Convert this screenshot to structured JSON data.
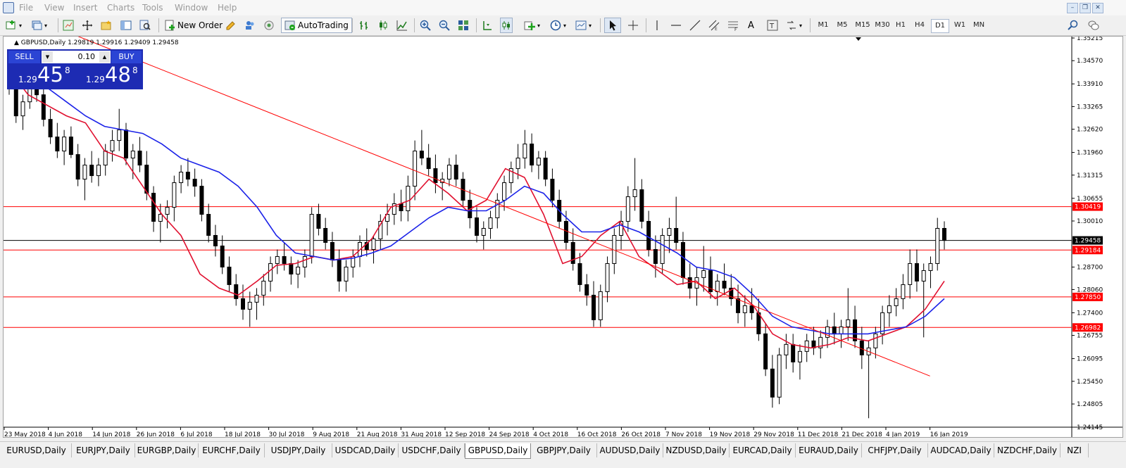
{
  "menu": [
    "File",
    "View",
    "Insert",
    "Charts",
    "Tools",
    "Window",
    "Help"
  ],
  "toolbar": {
    "new_order": "New Order",
    "autotrading": "AutoTrading"
  },
  "timeframes": [
    "M1",
    "M5",
    "M15",
    "M30",
    "H1",
    "H4",
    "D1",
    "W1",
    "MN"
  ],
  "active_timeframe": "D1",
  "symbol_line": "GBPUSD,Daily  1.29819 1.29916 1.29409 1.29458",
  "trade_panel": {
    "sell": "SELL",
    "buy": "BUY",
    "lot": "0.10",
    "sell_small": "1.29",
    "sell_big": "45",
    "sell_sup": "8",
    "buy_small": "1.29",
    "buy_big": "48",
    "buy_sup": "8"
  },
  "chart_data": {
    "type": "candlestick",
    "symbol": "GBPUSD",
    "period": "Daily",
    "price_axis": [
      "1.35215",
      "1.34570",
      "1.33910",
      "1.33265",
      "1.32620",
      "1.31960",
      "1.31315",
      "1.30655",
      "1.30010",
      "1.29458",
      "1.28700",
      "1.28060",
      "1.27400",
      "1.26755",
      "1.26095",
      "1.25450",
      "1.24805",
      "1.24145"
    ],
    "date_axis": [
      "23 May 2018",
      "4 Jun 2018",
      "14 Jun 2018",
      "26 Jun 2018",
      "6 Jul 2018",
      "18 Jul 2018",
      "30 Jul 2018",
      "9 Aug 2018",
      "21 Aug 2018",
      "31 Aug 2018",
      "12 Sep 2018",
      "24 Sep 2018",
      "4 Oct 2018",
      "16 Oct 2018",
      "26 Oct 2018",
      "7 Nov 2018",
      "19 Nov 2018",
      "29 Nov 2018",
      "11 Dec 2018",
      "21 Dec 2018",
      "4 Jan 2019",
      "16 Jan 2019"
    ],
    "ylim": [
      1.24145,
      1.35215
    ],
    "current_price": "1.29458",
    "hlines": [
      {
        "label": "1.30419",
        "price": 1.30419
      },
      {
        "label": "1.29184",
        "price": 1.29184
      },
      {
        "label": "1.27850",
        "price": 1.2785
      },
      {
        "label": "1.26982",
        "price": 1.26982
      }
    ],
    "trendline": {
      "from": [
        "2018-06-04",
        1.356
      ],
      "to": [
        "2019-01-30",
        1.256
      ]
    },
    "series": [
      {
        "name": "MA fast",
        "color": "#e0102f",
        "values": [
          1.343,
          1.336,
          1.333,
          1.33,
          1.328,
          1.32,
          1.318,
          1.31,
          1.302,
          1.296,
          1.285,
          1.281,
          1.279,
          1.283,
          1.2875,
          1.288,
          1.29,
          1.289,
          1.29,
          1.295,
          1.304,
          1.306,
          1.312,
          1.308,
          1.303,
          1.306,
          1.315,
          1.3125,
          1.302,
          1.288,
          1.29,
          1.296,
          1.3,
          1.29,
          1.286,
          1.282,
          1.283,
          1.278,
          1.281,
          1.276,
          1.268,
          1.265,
          1.264,
          1.265,
          1.267,
          1.266,
          1.268,
          1.27,
          1.275,
          1.283
        ]
      },
      {
        "name": "MA slow",
        "color": "#1b22e8",
        "values": [
          1.348,
          1.343,
          1.338,
          1.334,
          1.33,
          1.327,
          1.326,
          1.325,
          1.322,
          1.318,
          1.316,
          1.314,
          1.31,
          1.304,
          1.296,
          1.291,
          1.29,
          1.289,
          1.2895,
          1.291,
          1.293,
          1.297,
          1.301,
          1.304,
          1.303,
          1.303,
          1.306,
          1.31,
          1.308,
          1.302,
          1.297,
          1.297,
          1.299,
          1.297,
          1.294,
          1.291,
          1.287,
          1.286,
          1.284,
          1.279,
          1.273,
          1.27,
          1.269,
          1.268,
          1.268,
          1.268,
          1.269,
          1.27,
          1.273,
          1.278
        ]
      }
    ],
    "candles": [
      [
        1.342,
        1.346,
        1.336,
        1.338
      ],
      [
        1.338,
        1.34,
        1.328,
        1.33
      ],
      [
        1.33,
        1.336,
        1.326,
        1.334
      ],
      [
        1.334,
        1.34,
        1.332,
        1.338
      ],
      [
        1.338,
        1.343,
        1.334,
        1.336
      ],
      [
        1.336,
        1.338,
        1.327,
        1.329
      ],
      [
        1.329,
        1.332,
        1.322,
        1.324
      ],
      [
        1.324,
        1.328,
        1.318,
        1.32
      ],
      [
        1.32,
        1.326,
        1.316,
        1.324
      ],
      [
        1.324,
        1.327,
        1.318,
        1.319
      ],
      [
        1.319,
        1.322,
        1.31,
        1.312
      ],
      [
        1.312,
        1.318,
        1.306,
        1.316
      ],
      [
        1.316,
        1.32,
        1.311,
        1.313
      ],
      [
        1.313,
        1.318,
        1.31,
        1.316
      ],
      [
        1.316,
        1.322,
        1.313,
        1.32
      ],
      [
        1.32,
        1.326,
        1.317,
        1.323
      ],
      [
        1.323,
        1.332,
        1.32,
        1.326
      ],
      [
        1.326,
        1.328,
        1.316,
        1.318
      ],
      [
        1.318,
        1.322,
        1.312,
        1.32
      ],
      [
        1.32,
        1.324,
        1.314,
        1.316
      ],
      [
        1.316,
        1.32,
        1.306,
        1.308
      ],
      [
        1.308,
        1.31,
        1.297,
        1.3
      ],
      [
        1.3,
        1.305,
        1.294,
        1.302
      ],
      [
        1.302,
        1.306,
        1.298,
        1.304
      ],
      [
        1.304,
        1.313,
        1.3,
        1.311
      ],
      [
        1.311,
        1.316,
        1.308,
        1.314
      ],
      [
        1.314,
        1.318,
        1.31,
        1.312
      ],
      [
        1.312,
        1.315,
        1.307,
        1.31
      ],
      [
        1.31,
        1.312,
        1.3,
        1.302
      ],
      [
        1.302,
        1.305,
        1.294,
        1.296
      ],
      [
        1.296,
        1.299,
        1.29,
        1.293
      ],
      [
        1.293,
        1.296,
        1.285,
        1.287
      ],
      [
        1.287,
        1.29,
        1.28,
        1.282
      ],
      [
        1.282,
        1.285,
        1.276,
        1.278
      ],
      [
        1.278,
        1.282,
        1.272,
        1.275
      ],
      [
        1.275,
        1.28,
        1.27,
        1.277
      ],
      [
        1.277,
        1.281,
        1.272,
        1.279
      ],
      [
        1.279,
        1.285,
        1.276,
        1.283
      ],
      [
        1.283,
        1.29,
        1.28,
        1.288
      ],
      [
        1.288,
        1.292,
        1.285,
        1.29
      ],
      [
        1.29,
        1.294,
        1.286,
        1.288
      ],
      [
        1.288,
        1.29,
        1.282,
        1.285
      ],
      [
        1.285,
        1.289,
        1.281,
        1.287
      ],
      [
        1.287,
        1.292,
        1.284,
        1.29
      ],
      [
        1.29,
        1.304,
        1.288,
        1.302
      ],
      [
        1.302,
        1.305,
        1.296,
        1.298
      ],
      [
        1.298,
        1.301,
        1.292,
        1.294
      ],
      [
        1.294,
        1.297,
        1.287,
        1.289
      ],
      [
        1.289,
        1.292,
        1.28,
        1.283
      ],
      [
        1.283,
        1.289,
        1.28,
        1.287
      ],
      [
        1.287,
        1.292,
        1.284,
        1.29
      ],
      [
        1.29,
        1.296,
        1.287,
        1.294
      ],
      [
        1.294,
        1.298,
        1.29,
        1.292
      ],
      [
        1.292,
        1.296,
        1.288,
        1.295
      ],
      [
        1.295,
        1.302,
        1.292,
        1.3
      ],
      [
        1.3,
        1.305,
        1.296,
        1.302
      ],
      [
        1.302,
        1.308,
        1.299,
        1.305
      ],
      [
        1.305,
        1.309,
        1.3,
        1.303
      ],
      [
        1.303,
        1.313,
        1.3,
        1.31
      ],
      [
        1.31,
        1.323,
        1.306,
        1.32
      ],
      [
        1.32,
        1.326,
        1.316,
        1.318
      ],
      [
        1.318,
        1.322,
        1.313,
        1.315
      ],
      [
        1.315,
        1.319,
        1.308,
        1.311
      ],
      [
        1.311,
        1.314,
        1.306,
        1.312
      ],
      [
        1.312,
        1.318,
        1.31,
        1.316
      ],
      [
        1.316,
        1.319,
        1.31,
        1.312
      ],
      [
        1.312,
        1.314,
        1.304,
        1.306
      ],
      [
        1.306,
        1.309,
        1.298,
        1.301
      ],
      [
        1.301,
        1.304,
        1.294,
        1.296
      ],
      [
        1.296,
        1.3,
        1.292,
        1.298
      ],
      [
        1.298,
        1.303,
        1.295,
        1.301
      ],
      [
        1.301,
        1.308,
        1.298,
        1.306
      ],
      [
        1.306,
        1.313,
        1.303,
        1.311
      ],
      [
        1.311,
        1.317,
        1.308,
        1.315
      ],
      [
        1.315,
        1.322,
        1.312,
        1.318
      ],
      [
        1.318,
        1.326,
        1.315,
        1.322
      ],
      [
        1.322,
        1.325,
        1.314,
        1.316
      ],
      [
        1.316,
        1.32,
        1.312,
        1.318
      ],
      [
        1.318,
        1.32,
        1.31,
        1.312
      ],
      [
        1.312,
        1.315,
        1.304,
        1.306
      ],
      [
        1.306,
        1.309,
        1.298,
        1.3
      ],
      [
        1.3,
        1.303,
        1.292,
        1.294
      ],
      [
        1.294,
        1.298,
        1.286,
        1.288
      ],
      [
        1.288,
        1.291,
        1.28,
        1.282
      ],
      [
        1.282,
        1.285,
        1.276,
        1.279
      ],
      [
        1.279,
        1.283,
        1.27,
        1.272
      ],
      [
        1.272,
        1.282,
        1.27,
        1.28
      ],
      [
        1.28,
        1.29,
        1.277,
        1.288
      ],
      [
        1.288,
        1.298,
        1.285,
        1.296
      ],
      [
        1.296,
        1.303,
        1.292,
        1.3
      ],
      [
        1.3,
        1.31,
        1.297,
        1.307
      ],
      [
        1.307,
        1.318,
        1.303,
        1.309
      ],
      [
        1.309,
        1.312,
        1.298,
        1.3
      ],
      [
        1.3,
        1.303,
        1.29,
        1.292
      ],
      [
        1.292,
        1.296,
        1.284,
        1.288
      ],
      [
        1.288,
        1.298,
        1.285,
        1.296
      ],
      [
        1.296,
        1.301,
        1.291,
        1.298
      ],
      [
        1.298,
        1.307,
        1.292,
        1.294
      ],
      [
        1.294,
        1.297,
        1.282,
        1.284
      ],
      [
        1.284,
        1.288,
        1.278,
        1.281
      ],
      [
        1.281,
        1.287,
        1.276,
        1.284
      ],
      [
        1.284,
        1.293,
        1.28,
        1.286
      ],
      [
        1.286,
        1.29,
        1.278,
        1.28
      ],
      [
        1.28,
        1.285,
        1.276,
        1.283
      ],
      [
        1.283,
        1.288,
        1.279,
        1.281
      ],
      [
        1.281,
        1.285,
        1.276,
        1.278
      ],
      [
        1.278,
        1.282,
        1.271,
        1.274
      ],
      [
        1.274,
        1.279,
        1.27,
        1.276
      ],
      [
        1.276,
        1.281,
        1.272,
        1.274
      ],
      [
        1.274,
        1.278,
        1.266,
        1.268
      ],
      [
        1.268,
        1.271,
        1.256,
        1.258
      ],
      [
        1.258,
        1.262,
        1.247,
        1.25
      ],
      [
        1.25,
        1.264,
        1.248,
        1.262
      ],
      [
        1.262,
        1.268,
        1.258,
        1.265
      ],
      [
        1.265,
        1.268,
        1.257,
        1.26
      ],
      [
        1.26,
        1.265,
        1.255,
        1.263
      ],
      [
        1.263,
        1.268,
        1.26,
        1.266
      ],
      [
        1.266,
        1.27,
        1.262,
        1.264
      ],
      [
        1.264,
        1.269,
        1.261,
        1.267
      ],
      [
        1.267,
        1.272,
        1.264,
        1.27
      ],
      [
        1.27,
        1.274,
        1.265,
        1.268
      ],
      [
        1.268,
        1.272,
        1.264,
        1.27
      ],
      [
        1.27,
        1.281,
        1.266,
        1.272
      ],
      [
        1.272,
        1.276,
        1.264,
        1.266
      ],
      [
        1.266,
        1.27,
        1.258,
        1.262
      ],
      [
        1.262,
        1.266,
        1.244,
        1.264
      ],
      [
        1.264,
        1.27,
        1.261,
        1.268
      ],
      [
        1.268,
        1.276,
        1.265,
        1.274
      ],
      [
        1.274,
        1.279,
        1.27,
        1.276
      ],
      [
        1.276,
        1.281,
        1.273,
        1.278
      ],
      [
        1.278,
        1.285,
        1.275,
        1.282
      ],
      [
        1.282,
        1.292,
        1.278,
        1.288
      ],
      [
        1.288,
        1.292,
        1.28,
        1.283
      ],
      [
        1.283,
        1.288,
        1.267,
        1.286
      ],
      [
        1.286,
        1.29,
        1.281,
        1.288
      ],
      [
        1.288,
        1.301,
        1.286,
        1.298
      ],
      [
        1.298,
        1.3,
        1.292,
        1.29458
      ]
    ]
  },
  "tabs": [
    "EURUSD,Daily",
    "EURJPY,Daily",
    "EURGBP,Daily",
    "EURCHF,Daily",
    "USDJPY,Daily",
    "USDCAD,Daily",
    "USDCHF,Daily",
    "GBPUSD,Daily",
    "GBPJPY,Daily",
    "AUDUSD,Daily",
    "NZDUSD,Daily",
    "EURCAD,Daily",
    "EURAUD,Daily",
    "CHFJPY,Daily",
    "AUDCAD,Daily",
    "NZDCHF,Daily",
    "NZI"
  ],
  "active_tab": "GBPUSD,Daily"
}
